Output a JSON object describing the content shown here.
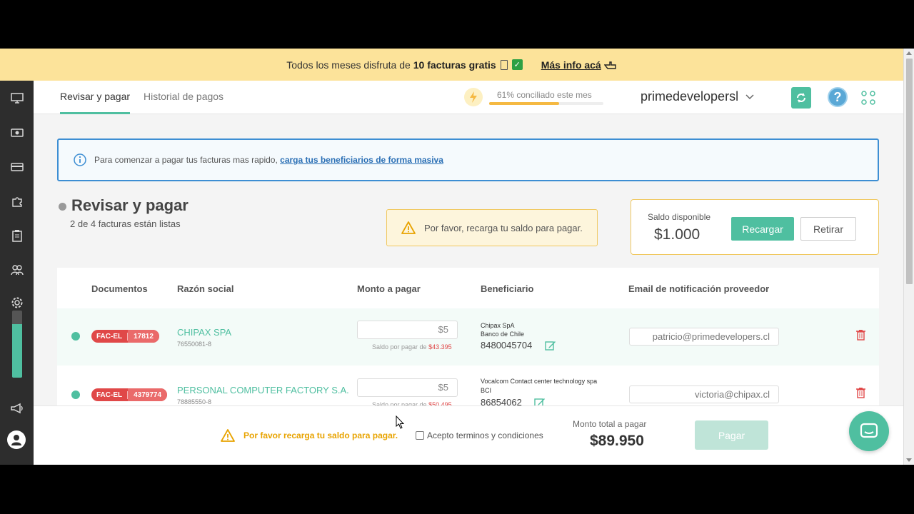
{
  "promo": {
    "text_before": "Todos los meses disfruta de",
    "text_bold": "10 facturas gratis",
    "more_link": "Más info acá"
  },
  "header": {
    "tabs": [
      {
        "label": "Revisar y pagar",
        "active": true
      },
      {
        "label": "Historial de pagos",
        "active": false
      }
    ],
    "conciliation_label": "61% conciliado este mes",
    "conciliation_percent": 61,
    "company": "primedevelopersl",
    "help_label": "?"
  },
  "sidebar": {
    "icons": [
      "monitor-icon",
      "money-icon",
      "card-icon",
      "puzzle-icon",
      "clipboard-icon",
      "users-icon",
      "gear-icon"
    ],
    "progress_fraction": 0.8,
    "bottom_icons": [
      "megaphone-icon",
      "user-avatar-icon"
    ]
  },
  "info_banner": {
    "text": "Para comenzar a pagar tus facturas mas rapido,",
    "link": "carga tus beneficiarios de forma masiva"
  },
  "section": {
    "title": "Revisar y pagar",
    "subtitle": "2 de 4 facturas están listas",
    "warning": "Por favor, recarga tu saldo para pagar."
  },
  "balance": {
    "label": "Saldo disponible",
    "value": "$1.000",
    "recharge_label": "Recargar",
    "withdraw_label": "Retirar"
  },
  "table": {
    "headers": [
      "Documentos",
      "Razón social",
      "Monto a pagar",
      "Beneficiario",
      "Email de notificación proveedor"
    ],
    "rows": [
      {
        "doc_type": "FAC-EL",
        "doc_number": "17812",
        "company": "CHIPAX SPA",
        "rut": "76550081-8",
        "amount": "$5",
        "saldo_label": "Saldo por pagar de",
        "saldo_value": "$43.395",
        "beneficiary_name": "Chipax SpA",
        "beneficiary_bank": "Banco de Chile",
        "account": "8480045704",
        "email": "patricio@primedevelopers.cl"
      },
      {
        "doc_type": "FAC-EL",
        "doc_number": "4379774",
        "company": "PERSONAL COMPUTER FACTORY S.A.",
        "rut": "78885550-8",
        "amount": "$5",
        "saldo_label": "Saldo por pagar de",
        "saldo_value": "$50.495",
        "beneficiary_name": "Vocalcom Contact center technology spa",
        "beneficiary_bank": "BCI",
        "account": "86854062",
        "email": "victoria@chipax.cl"
      }
    ]
  },
  "footer": {
    "warning": "Por favor recarga tu saldo para pagar.",
    "terms_label": "Acepto terminos y condiciones",
    "total_label": "Monto total a pagar",
    "total_value": "$89.950",
    "pay_label": "Pagar"
  },
  "colors": {
    "accent": "#4fbfa0",
    "warning": "#f0c860",
    "danger": "#e04848",
    "info": "#3d8ed3",
    "promo_bg": "#fce39a"
  }
}
